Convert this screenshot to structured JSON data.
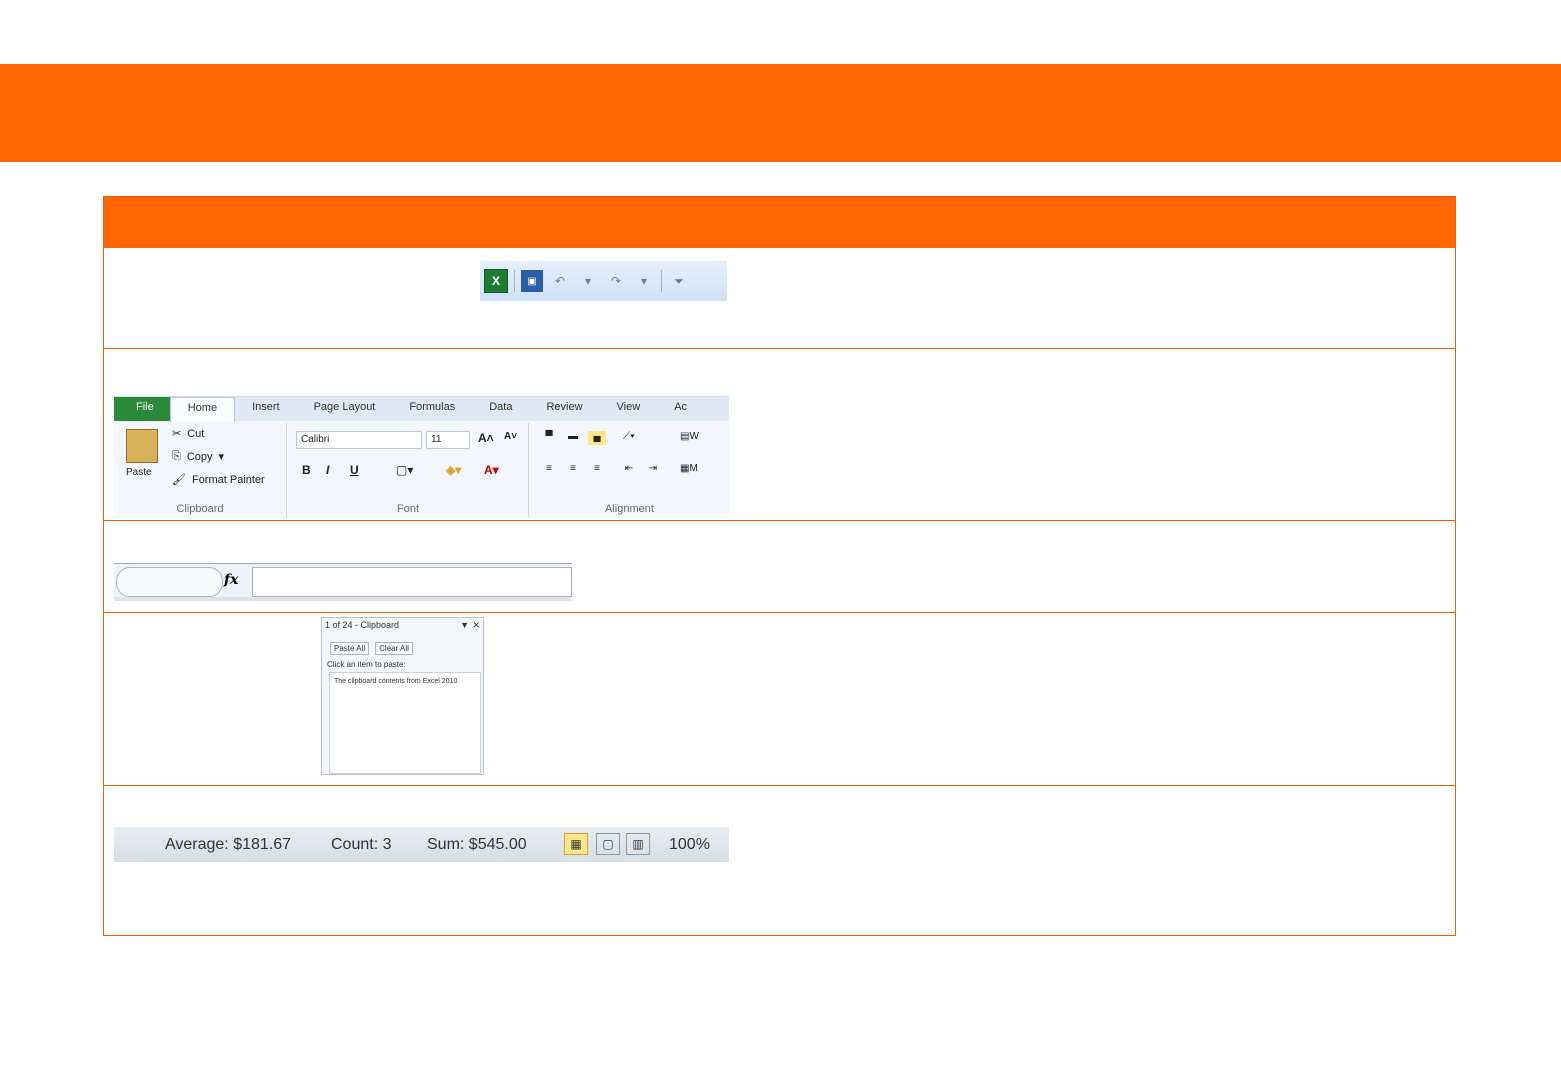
{
  "quick_access_toolbar": {
    "app_icon": "excel-icon",
    "save_icon": "save-icon",
    "undo_icon": "undo-icon",
    "redo_icon": "redo-icon",
    "customize_icon": "customize-qat-icon"
  },
  "ribbon": {
    "tabs": [
      "File",
      "Home",
      "Insert",
      "Page Layout",
      "Formulas",
      "Data",
      "Review",
      "View",
      "Ac"
    ],
    "active_tab": "Home",
    "clipboard": {
      "paste": "Paste",
      "cut": "Cut",
      "copy": "Copy",
      "format_painter": "Format Painter",
      "group_label": "Clipboard"
    },
    "font": {
      "font_name": "Calibri",
      "font_size": "11",
      "bold": "B",
      "italic": "I",
      "underline": "U",
      "group_label": "Font"
    },
    "alignment": {
      "wrap": "W",
      "merge": "M",
      "group_label": "Alignment"
    }
  },
  "formula_bar": {
    "fx_label": "fx",
    "value": ""
  },
  "clipboard_pane": {
    "title": "1 of 24 - Clipboard",
    "paste_all": "Paste All",
    "clear_all": "Clear All",
    "hint": "Click an item to paste:",
    "item_text": "The clipboard contents from Excel 2010"
  },
  "status_bar": {
    "average": "Average: $181.67",
    "count": "Count: 3",
    "sum": "Sum: $545.00",
    "zoom": "100%"
  },
  "colors": {
    "banner": "#ff6600",
    "table_border": "#e8620b"
  }
}
